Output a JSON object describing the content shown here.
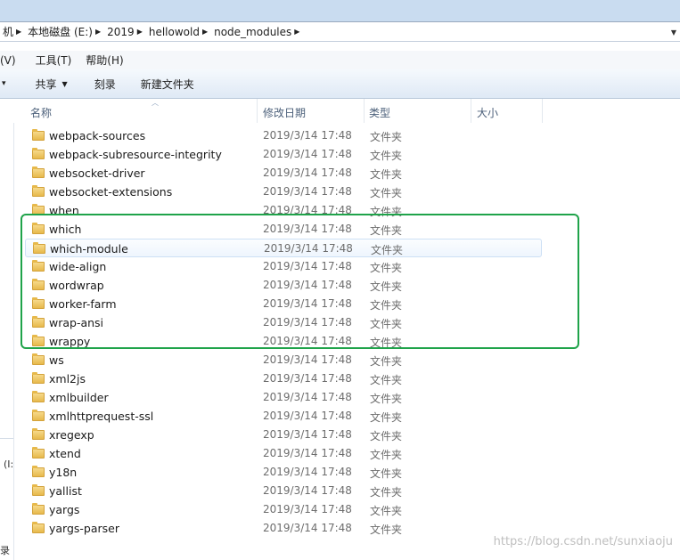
{
  "address_bar": {
    "crumbs": [
      "机",
      "本地磁盘 (E:)",
      "2019",
      "hellowold",
      "node_modules"
    ]
  },
  "menu": {
    "items": [
      "(V)",
      "工具(T)",
      "帮助(H)"
    ]
  },
  "toolbar": {
    "left_arrow": "▾",
    "share_label": "共享",
    "burn_label": "刻录",
    "new_folder_label": "新建文件夹"
  },
  "left_pane": {
    "drive_label": "(I:",
    "bottom_label": "录"
  },
  "columns": {
    "name": "名称",
    "date": "修改日期",
    "type": "类型",
    "size": "大小"
  },
  "rows": [
    {
      "name": "webpack-sources",
      "date": "2019/3/14 17:48",
      "type": "文件夹"
    },
    {
      "name": "webpack-subresource-integrity",
      "date": "2019/3/14 17:48",
      "type": "文件夹"
    },
    {
      "name": "websocket-driver",
      "date": "2019/3/14 17:48",
      "type": "文件夹"
    },
    {
      "name": "websocket-extensions",
      "date": "2019/3/14 17:48",
      "type": "文件夹"
    },
    {
      "name": "when",
      "date": "2019/3/14 17:48",
      "type": "文件夹"
    },
    {
      "name": "which",
      "date": "2019/3/14 17:48",
      "type": "文件夹"
    },
    {
      "name": "which-module",
      "date": "2019/3/14 17:48",
      "type": "文件夹"
    },
    {
      "name": "wide-align",
      "date": "2019/3/14 17:48",
      "type": "文件夹"
    },
    {
      "name": "wordwrap",
      "date": "2019/3/14 17:48",
      "type": "文件夹"
    },
    {
      "name": "worker-farm",
      "date": "2019/3/14 17:48",
      "type": "文件夹"
    },
    {
      "name": "wrap-ansi",
      "date": "2019/3/14 17:48",
      "type": "文件夹"
    },
    {
      "name": "wrappy",
      "date": "2019/3/14 17:48",
      "type": "文件夹"
    },
    {
      "name": "ws",
      "date": "2019/3/14 17:48",
      "type": "文件夹"
    },
    {
      "name": "xml2js",
      "date": "2019/3/14 17:48",
      "type": "文件夹"
    },
    {
      "name": "xmlbuilder",
      "date": "2019/3/14 17:48",
      "type": "文件夹"
    },
    {
      "name": "xmlhttprequest-ssl",
      "date": "2019/3/14 17:48",
      "type": "文件夹"
    },
    {
      "name": "xregexp",
      "date": "2019/3/14 17:48",
      "type": "文件夹"
    },
    {
      "name": "xtend",
      "date": "2019/3/14 17:48",
      "type": "文件夹"
    },
    {
      "name": "y18n",
      "date": "2019/3/14 17:48",
      "type": "文件夹"
    },
    {
      "name": "yallist",
      "date": "2019/3/14 17:48",
      "type": "文件夹"
    },
    {
      "name": "yargs",
      "date": "2019/3/14 17:48",
      "type": "文件夹"
    },
    {
      "name": "yargs-parser",
      "date": "2019/3/14 17:48",
      "type": "文件夹"
    }
  ],
  "selected_row": "which-module",
  "highlight_color": "#1fa34a",
  "watermark": "https://blog.csdn.net/sunxiaoju"
}
